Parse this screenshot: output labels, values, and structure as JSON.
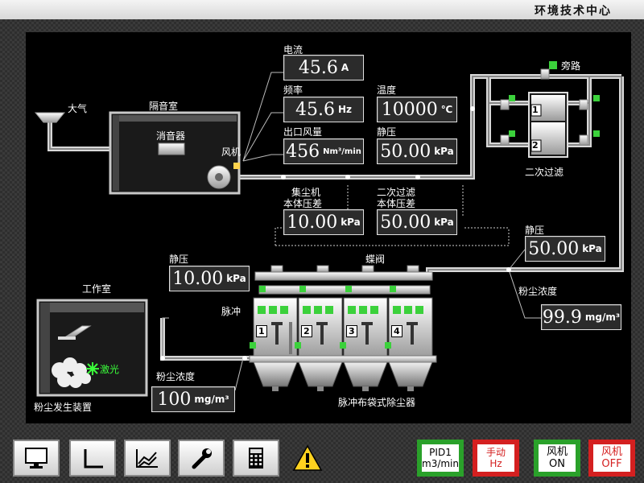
{
  "header": {
    "title": "环境技术中心"
  },
  "labels": {
    "atmosphere": "大气",
    "soundproof_room": "隔音室",
    "muffler": "消音器",
    "fan": "风机",
    "bypass": "旁路",
    "secondary_filter": "二次过滤",
    "butterfly_valve": "蝶阀",
    "pulse": "脉冲",
    "workroom": "工作室",
    "laser": "激光",
    "dust_generator": "粉尘发生装置",
    "bag_filter": "脉冲布袋式除尘器"
  },
  "readouts": {
    "current": {
      "label": "电流",
      "value": "45.6",
      "unit": "A"
    },
    "frequency": {
      "label": "频率",
      "value": "45.6",
      "unit": "Hz"
    },
    "outlet_flow": {
      "label": "出口风量",
      "value": "456",
      "unit": "Nm³/min"
    },
    "temperature": {
      "label": "温度",
      "value": "10000",
      "unit": "℃"
    },
    "static_pressure_top": {
      "label": "静压",
      "value": "50.00",
      "unit": "kPa"
    },
    "collector_dp": {
      "label1": "集尘机",
      "label2": "本体压差",
      "value": "10.00",
      "unit": "kPa"
    },
    "secondary_dp": {
      "label1": "二次过滤",
      "label2": "本体压差",
      "value": "50.00",
      "unit": "kPa"
    },
    "static_pressure_right": {
      "label": "静压",
      "value": "50.00",
      "unit": "kPa"
    },
    "dust_conc_right": {
      "label": "粉尘浓度",
      "value": "99.9",
      "unit": "mg/m³"
    },
    "static_pressure_left": {
      "label": "静压",
      "value": "10.00",
      "unit": "kPa"
    },
    "dust_conc_left": {
      "label": "粉尘浓度",
      "value": "100",
      "unit": "mg/m³"
    }
  },
  "filter_numbers": [
    "1",
    "2"
  ],
  "chamber_numbers": [
    "1",
    "2",
    "3",
    "4"
  ],
  "toolbar": {
    "monitor_icon": "monitor-icon",
    "axis_icon": "axis-icon",
    "trend_icon": "trend-chart-icon",
    "wrench_icon": "wrench-icon",
    "calculator_icon": "calculator-icon",
    "warning_icon": "warning-icon",
    "pid": {
      "line1": "PID1",
      "line2": "m3/min"
    },
    "manual": {
      "line1": "手动",
      "line2": "Hz"
    },
    "fan_on": {
      "line1": "风机",
      "line2": "ON"
    },
    "fan_off": {
      "line1": "风机",
      "line2": "OFF"
    }
  },
  "colors": {
    "indicator_green": "#3bd13b",
    "button_green": "#2aa12a",
    "button_red": "#d42020",
    "fan_indicator": "#ffd34d",
    "laser": "#3bff3b"
  }
}
